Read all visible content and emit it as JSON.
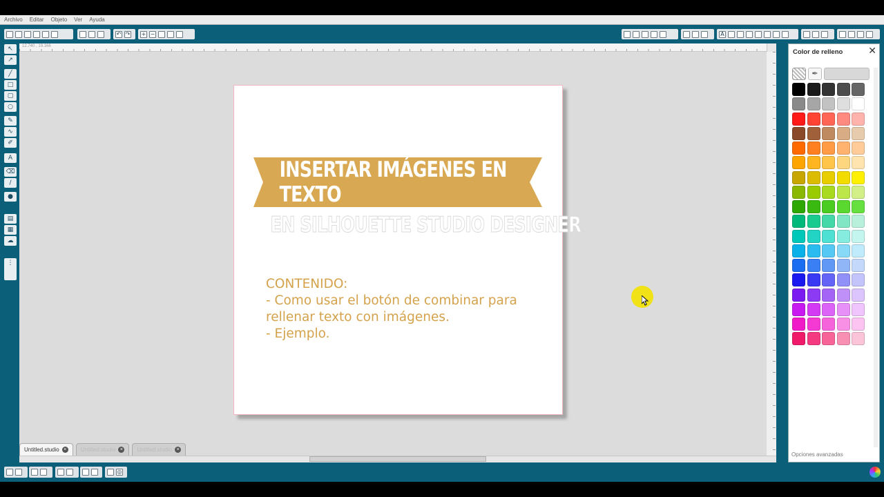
{
  "menu": [
    "Archivo",
    "Editar",
    "Objeto",
    "Ver",
    "Ayuda"
  ],
  "ruler_readout": "12.740 , 19.166",
  "page": {
    "banner_title": "INSERTAR IMÁGENES EN TEXTO",
    "banner_color": "#d8a852",
    "subtitle": "EN SILHOUETTE STUDIO DESIGNER",
    "content_lines": [
      "CONTENIDO:",
      "- Como usar el botón de combinar para",
      "rellenar texto con imágenes.",
      "- Ejemplo."
    ],
    "text_color": "#d4a24b"
  },
  "tabs": [
    {
      "label": "Untitled.studio",
      "active": true
    },
    {
      "label": "Untitled.studio",
      "active": false
    },
    {
      "label": "Untitled.studio",
      "active": false
    }
  ],
  "panel": {
    "title": "Color de relleno",
    "close_icon": "close-icon",
    "footer_link": "Opciones avanzadas",
    "swatches": [
      "#000000",
      "#1a1a1a",
      "#333333",
      "#4d4d4d",
      "#666666",
      "#8a8a8a",
      "#a6a6a6",
      "#c2c2c2",
      "#dedede",
      "#ffffff",
      "#ff1a1a",
      "#ff4433",
      "#ff6655",
      "#ff8a80",
      "#ffb3ad",
      "#8a4a2a",
      "#a0603a",
      "#c08a60",
      "#d8ad85",
      "#e6ccad",
      "#ff6a00",
      "#ff8020",
      "#ff9a45",
      "#ffb36e",
      "#ffcc99",
      "#ffa500",
      "#ffb520",
      "#ffc44a",
      "#ffd680",
      "#ffe4b0",
      "#c7a600",
      "#dcbc00",
      "#e8cd00",
      "#f2dc00",
      "#fff000",
      "#8ab800",
      "#9acb00",
      "#aada20",
      "#bce64a",
      "#d3f088",
      "#2ea800",
      "#3aba10",
      "#4acc20",
      "#5ad830",
      "#66e040",
      "#00b87a",
      "#1acb90",
      "#44d8a8",
      "#80e6c4",
      "#b8f0dc",
      "#00c8b8",
      "#22d4c4",
      "#4ee0d2",
      "#86ecdf",
      "#c4f6ef",
      "#0ab0e8",
      "#2abcf0",
      "#55c8f4",
      "#88d8f8",
      "#c0ebfc",
      "#1a6cf0",
      "#3a80f4",
      "#6098f6",
      "#90b6f8",
      "#c4d8fc",
      "#1a1af0",
      "#3a3af4",
      "#6464f6",
      "#9090f8",
      "#c4c4fc",
      "#7a1af0",
      "#8c3af4",
      "#a464f6",
      "#bf90f8",
      "#dcc4fc",
      "#c81af0",
      "#d23af4",
      "#dc64f6",
      "#e690f8",
      "#f0c4fc",
      "#f01ac8",
      "#f43ad2",
      "#f664dc",
      "#f890e6",
      "#fcc4f0",
      "#f01a6a",
      "#f43a80",
      "#f66498",
      "#f890b4",
      "#fcc4d8"
    ]
  }
}
